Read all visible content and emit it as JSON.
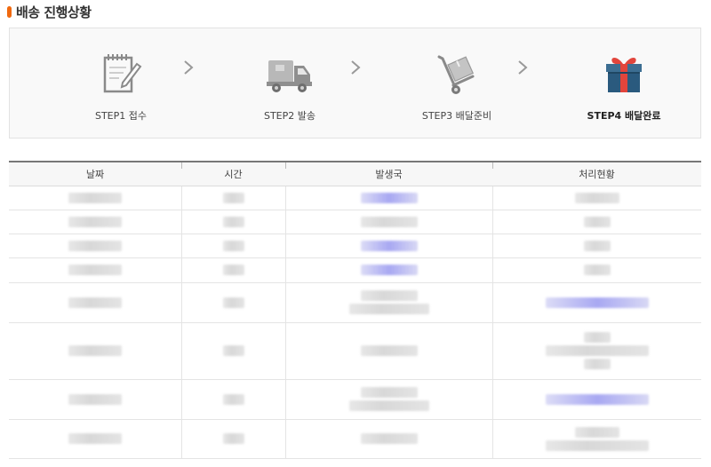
{
  "section": {
    "title": "배송 진행상황",
    "marker_color": "#f0690f"
  },
  "steps": [
    {
      "label": "STEP1 접수",
      "icon": "notepad-pencil-icon",
      "active": false
    },
    {
      "label": "STEP2 발송",
      "icon": "delivery-truck-icon",
      "active": false
    },
    {
      "label": "STEP3 배달준비",
      "icon": "hand-truck-box-icon",
      "active": false
    },
    {
      "label": "STEP4 배달완료",
      "icon": "gift-box-icon",
      "active": true
    }
  ],
  "table": {
    "headers": {
      "date": "날짜",
      "time": "시간",
      "location": "발생국",
      "status": "처리현황"
    },
    "rows": [
      {
        "date": "",
        "time": "",
        "location": [
          ""
        ],
        "status": [
          ""
        ]
      },
      {
        "date": "",
        "time": "",
        "location": [
          ""
        ],
        "status": [
          ""
        ]
      },
      {
        "date": "",
        "time": "",
        "location": [
          ""
        ],
        "status": [
          ""
        ]
      },
      {
        "date": "",
        "time": "",
        "location": [
          ""
        ],
        "status": [
          ""
        ]
      },
      {
        "date": "",
        "time": "",
        "location": [
          "",
          ""
        ],
        "status": [
          ""
        ]
      },
      {
        "date": "",
        "time": "",
        "location": [
          ""
        ],
        "status": [
          "",
          "",
          ""
        ]
      },
      {
        "date": "",
        "time": "",
        "location": [
          "",
          ""
        ],
        "status": [
          ""
        ]
      },
      {
        "date": "",
        "time": "",
        "location": [
          ""
        ],
        "status": [
          "",
          ""
        ]
      }
    ]
  },
  "colors": {
    "accent": "#f0690f",
    "link": "#6b6be8",
    "gift_box": "#2a5a7e",
    "gift_ribbon": "#e2453c"
  }
}
